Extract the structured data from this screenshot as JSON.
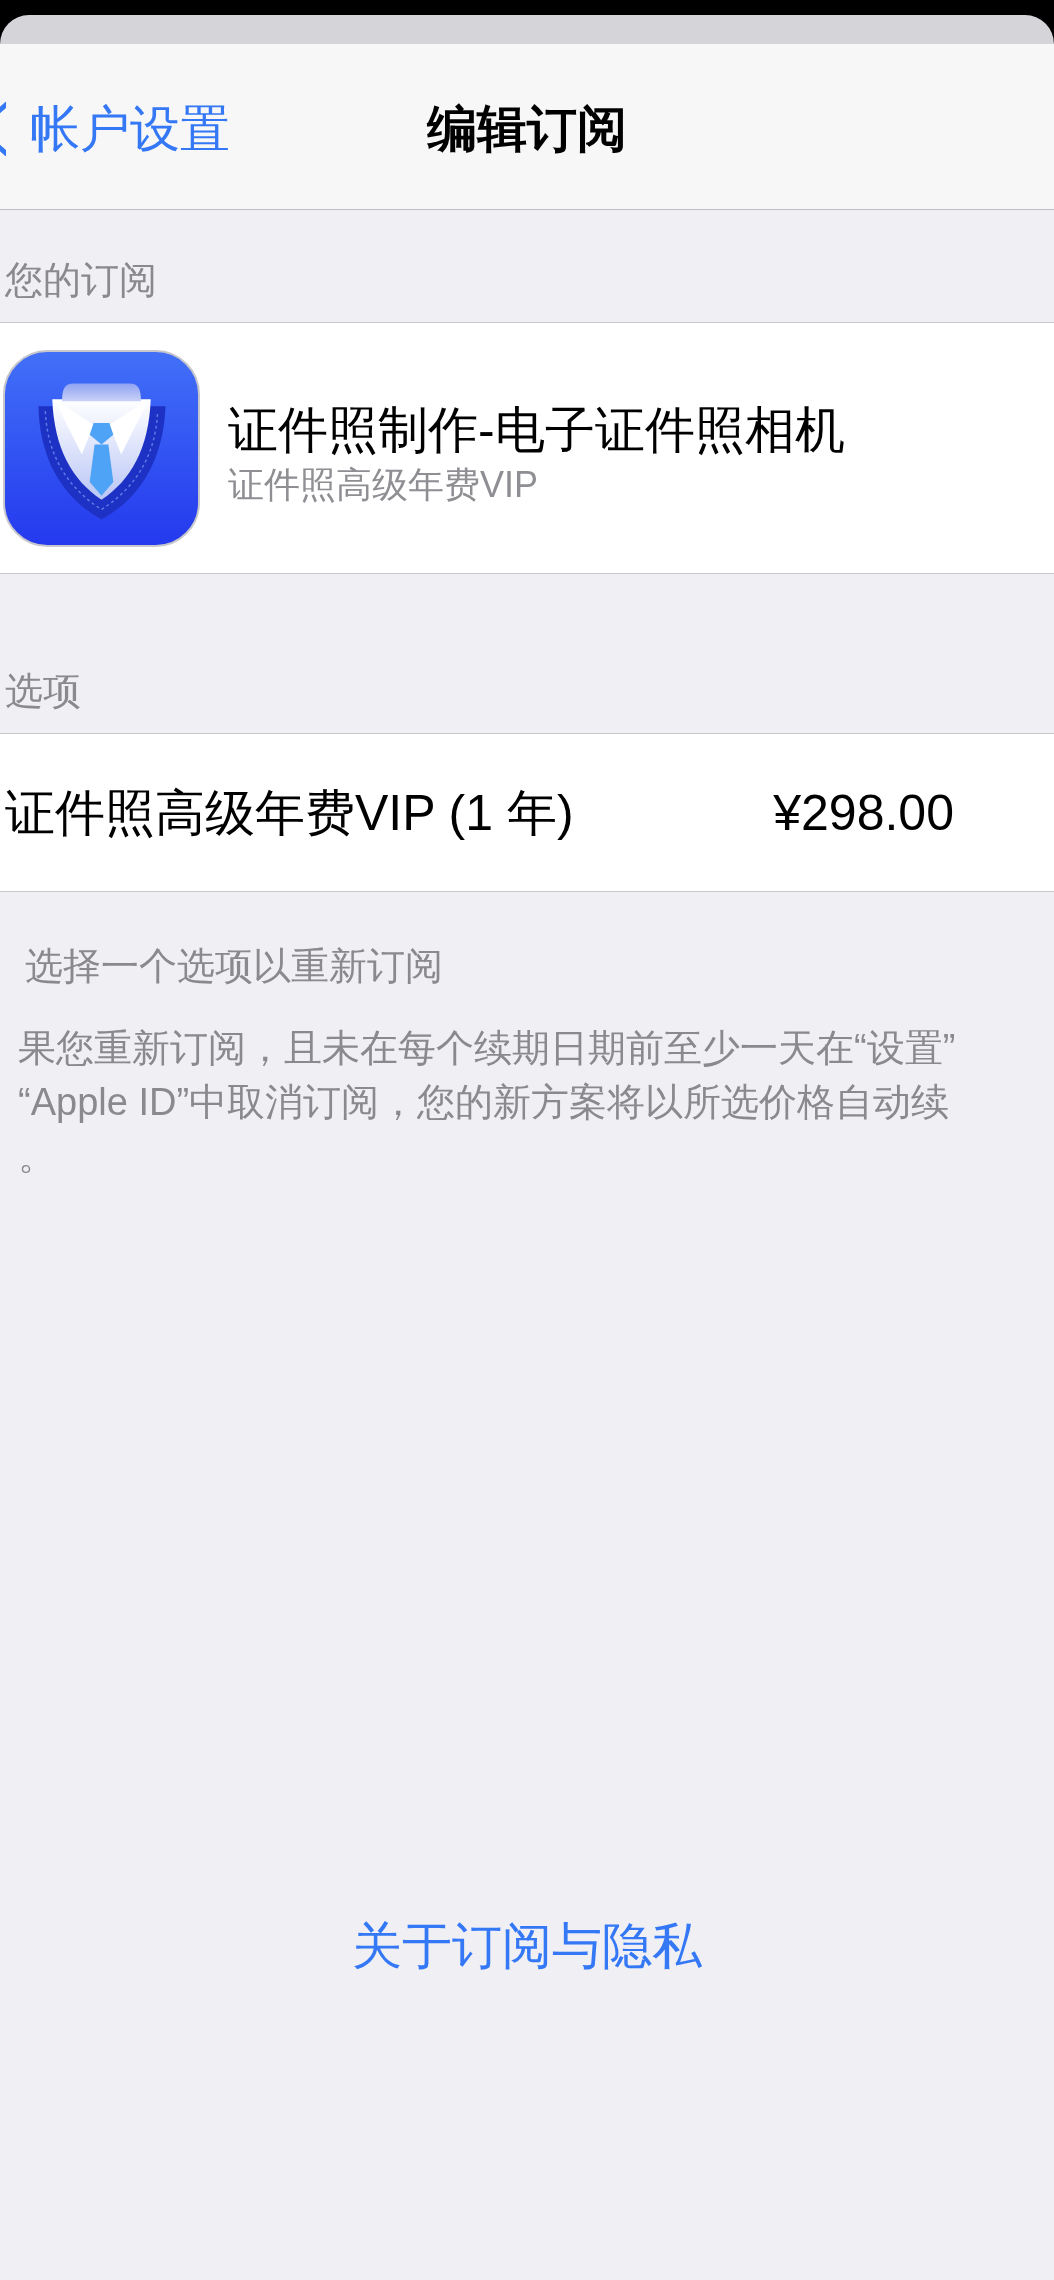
{
  "navigation": {
    "back_label": "帐户设置",
    "title": "编辑订阅"
  },
  "subscription_section": {
    "header": "您的订阅",
    "app_name": "证件照制作-电子证件照相机",
    "plan": "证件照高级年费VIP"
  },
  "options_section": {
    "header": "选项",
    "options": [
      {
        "label": "证件照高级年费VIP (1 年)",
        "price": "¥298.00"
      }
    ],
    "footer": "选择一个选项以重新订阅",
    "notice_lines": [
      "果您重新订阅，且未在每个续期日期前至少一天在“设置”",
      "“Apple ID”中取消订阅，您的新方案将以所选价格自动续",
      "。"
    ]
  },
  "link": "关于订阅与隐私"
}
